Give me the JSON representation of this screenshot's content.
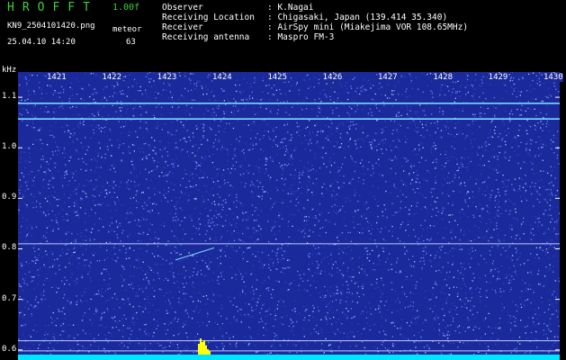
{
  "header": {
    "title": "HROFFT",
    "version": "1.00f",
    "filename": "KN9_2504101420.png",
    "datetime": "25.04.10 14:20",
    "meteor_label": "meteor",
    "meteor_count": "63"
  },
  "info": [
    {
      "key": "Observer",
      "value": ": K.Nagai"
    },
    {
      "key": "Receiving Location",
      "value": ": Chigasaki, Japan (139.414 35.340)"
    },
    {
      "key": "Receiver",
      "value": ": AirSpy mini (Miakejima VOR 108.65MHz)"
    },
    {
      "key": "Receiving antenna",
      "value": ": Maspro FM-3"
    }
  ],
  "axis": {
    "unit": "kHz",
    "y_labels": [
      "1.1",
      "1.0",
      "0.9",
      "0.8",
      "0.7",
      "0.6"
    ],
    "time_labels": [
      "1421",
      "1422",
      "1423",
      "1424",
      "1425",
      "1426",
      "1427",
      "1428",
      "1429",
      "1430"
    ]
  },
  "chart_data": {
    "type": "heatmap",
    "title": "",
    "xlabel": "",
    "ylabel": "kHz",
    "x_ticks": [
      "1421",
      "1422",
      "1423",
      "1424",
      "1425",
      "1426",
      "1427",
      "1428",
      "1429",
      "1430"
    ],
    "ylim": [
      0.58,
      1.15
    ],
    "y_ticks": [
      1.1,
      1.0,
      0.9,
      0.8,
      0.7,
      0.6
    ],
    "horizontal_lines_khz": [
      1.088,
      1.057,
      0.81,
      0.618,
      0.598
    ],
    "colors": {
      "background": "#1a2a9a",
      "noise": "#6d86ff",
      "line": "#7ad8ff",
      "burst": "#ffff00",
      "floor": "#00e5ff"
    }
  }
}
